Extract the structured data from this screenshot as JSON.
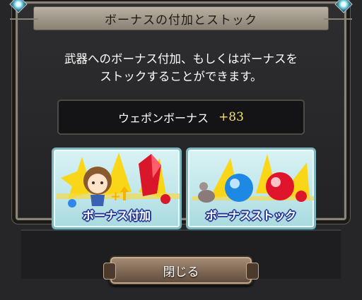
{
  "dialog": {
    "title": "ボーナスの付加とストック",
    "description_line1": "武器へのボーナス付加、もしくはボーナスを",
    "description_line2": "ストックすることができます。",
    "bonus": {
      "label": "ウェポンボーナス",
      "value": "+83"
    },
    "options": [
      {
        "label": "ボーナス付加",
        "icon": "character-with-red-crystal"
      },
      {
        "label": "ボーナスストック",
        "icon": "blue-and-red-orbs"
      }
    ],
    "close_label": "閉じる"
  },
  "colors": {
    "bonus_value": "#f4e56a",
    "option_button_bg": "#bfe6ea",
    "option_label_outline": "#263a9a",
    "close_button": "#7e6653"
  }
}
